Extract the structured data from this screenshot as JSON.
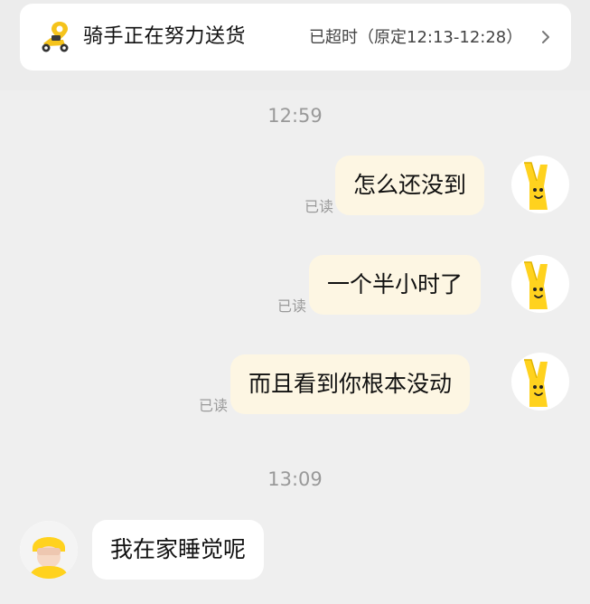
{
  "status_card": {
    "title": "骑手正在努力送货",
    "detail": "已超时（原定12:13-12:28）",
    "rider_icon": "rider-scooter-icon",
    "chevron_icon": "chevron-right-icon"
  },
  "colors": {
    "outgoing_bubble": "#fdf6e3",
    "incoming_bubble": "#ffffff",
    "background": "#efefef",
    "accent_yellow": "#ffd21e"
  },
  "chat": {
    "timestamp_1": "12:59",
    "timestamp_2": "13:09",
    "messages": [
      {
        "text": "怎么还没到",
        "read": "已读",
        "avatar_icon": "bunny-hand-avatar-icon"
      },
      {
        "text": "一个半小时了",
        "read": "已读",
        "avatar_icon": "bunny-hand-avatar-icon"
      },
      {
        "text": "而且看到你根本没动",
        "read": "已读",
        "avatar_icon": "bunny-hand-avatar-icon"
      },
      {
        "text": "我在家睡觉呢",
        "avatar_icon": "rider-avatar-icon"
      }
    ]
  }
}
